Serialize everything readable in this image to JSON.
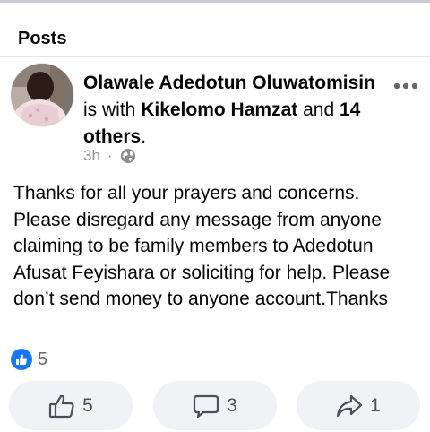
{
  "section": {
    "title": "Posts"
  },
  "post": {
    "author": "Olawale Adedotun Oluwatomisin",
    "with_text": "is with",
    "tagged_person": "Kikelomo Hamzat",
    "and_text": "and",
    "others": "14 others",
    "period": ".",
    "time": "3h",
    "separator": "·",
    "audience_icon": "globe-icon",
    "body": "Thanks for all your prayers and concerns. Please disregard any message from anyone claiming to be family members to Adedotun Afusat Feyishara or soliciting for help. Please don’t send money to anyone account.Thanks",
    "reaction_count": "5"
  },
  "actions": {
    "like_count": "5",
    "comment_count": "3",
    "share_count": "1"
  },
  "colors": {
    "accent": "#1877f2",
    "pill_background": "#f0f2f5",
    "muted_text": "#65676b"
  }
}
